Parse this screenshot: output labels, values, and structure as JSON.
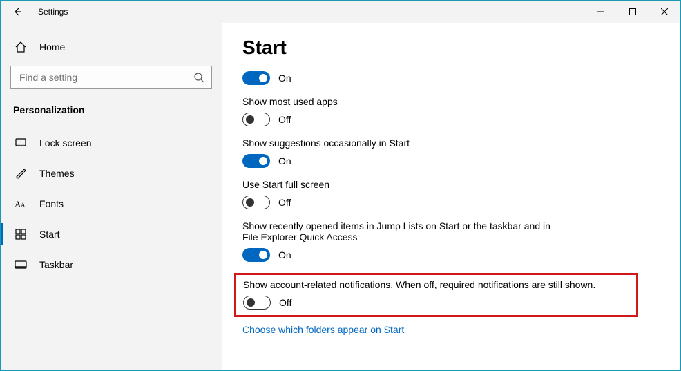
{
  "window": {
    "title": "Settings"
  },
  "sidebar": {
    "home_label": "Home",
    "search_placeholder": "Find a setting",
    "section_header": "Personalization",
    "items": [
      {
        "id": "lock-screen",
        "label": "Lock screen"
      },
      {
        "id": "themes",
        "label": "Themes"
      },
      {
        "id": "fonts",
        "label": "Fonts"
      },
      {
        "id": "start",
        "label": "Start"
      },
      {
        "id": "taskbar",
        "label": "Taskbar"
      }
    ]
  },
  "content": {
    "page_title": "Start",
    "settings": [
      {
        "label": "",
        "state": "on",
        "state_text": "On"
      },
      {
        "label": "Show most used apps",
        "state": "off",
        "state_text": "Off"
      },
      {
        "label": "Show suggestions occasionally in Start",
        "state": "on",
        "state_text": "On"
      },
      {
        "label": "Use Start full screen",
        "state": "off",
        "state_text": "Off"
      },
      {
        "label": "Show recently opened items in Jump Lists on Start or the taskbar and in File Explorer Quick Access",
        "state": "on",
        "state_text": "On"
      },
      {
        "label": "Show account-related notifications. When off, required notifications are still shown.",
        "state": "off",
        "state_text": "Off"
      }
    ],
    "link_text": "Choose which folders appear on Start"
  },
  "colors": {
    "accent": "#0067c0",
    "highlight_border": "#d01818"
  }
}
